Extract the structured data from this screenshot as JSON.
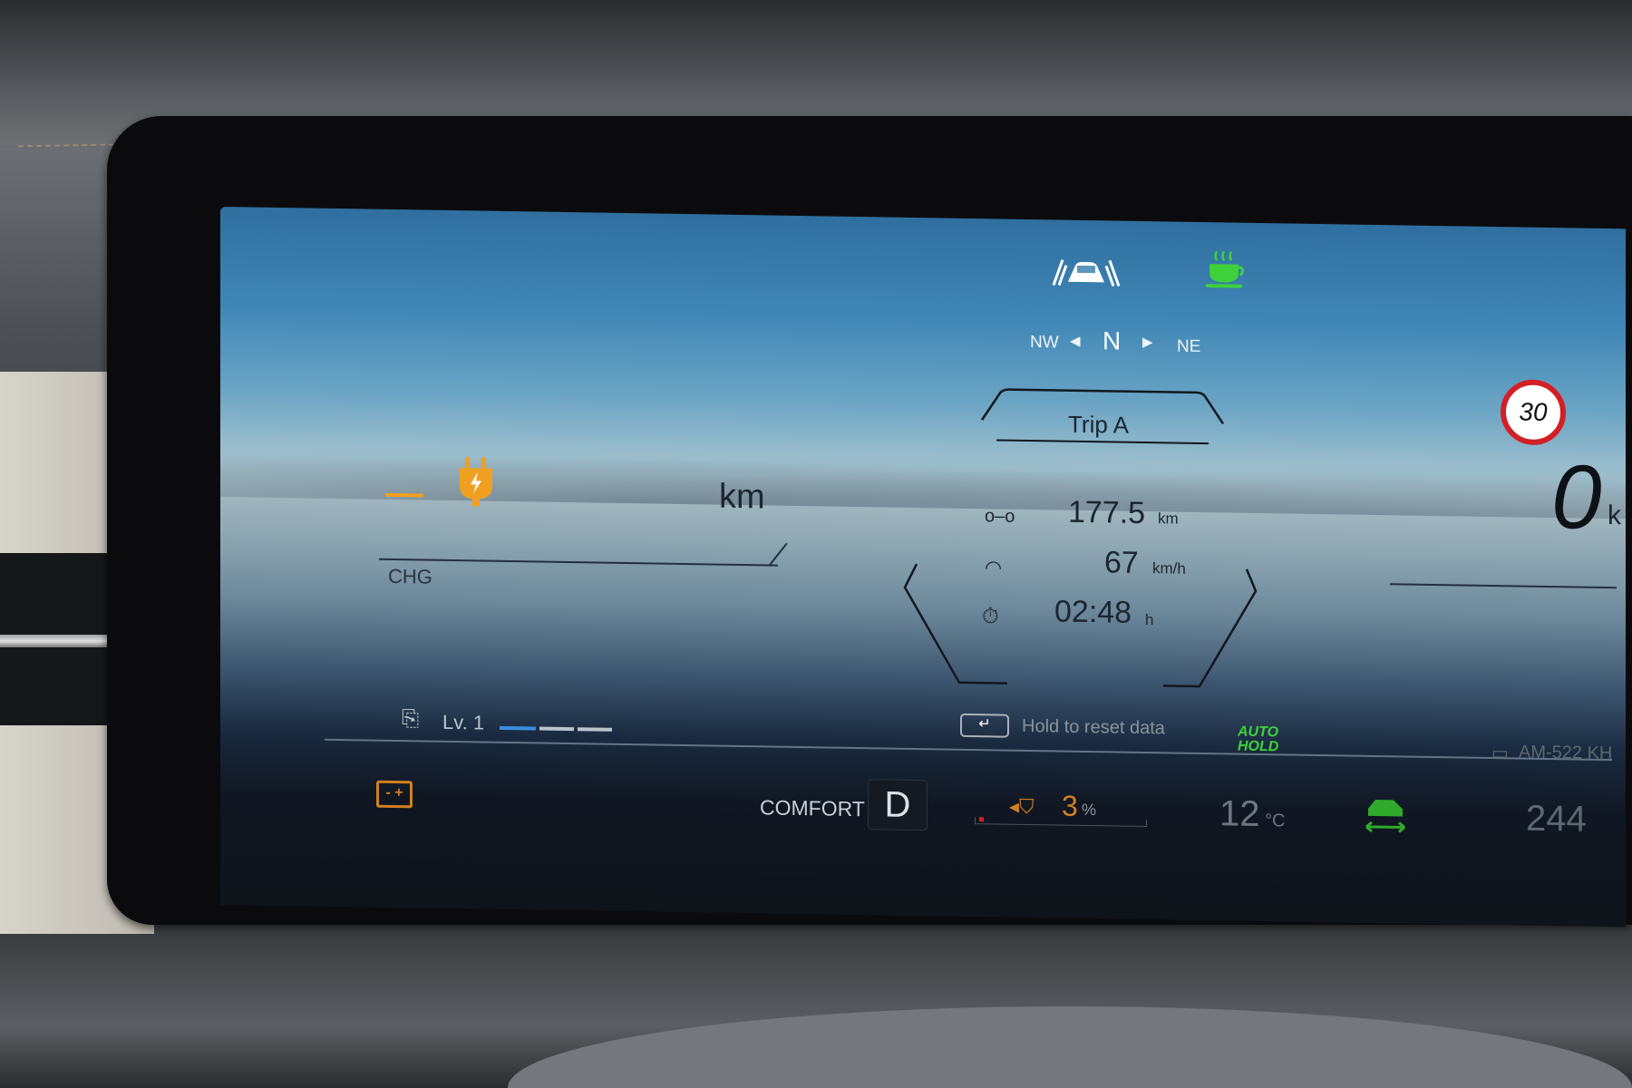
{
  "top_icons": {
    "driver_assist": "lane-assist-car-icon",
    "break_reminder": "coffee-cup-icon",
    "break_color": "#3fd13a"
  },
  "compass": {
    "left": "NW",
    "heading": "N",
    "right": "NE"
  },
  "trip": {
    "tab": "Trip A",
    "distance": "177.5",
    "distance_unit": "km",
    "avg_speed": "67",
    "avg_speed_unit": "km/h",
    "time": "02:48",
    "time_unit": "h"
  },
  "range": {
    "unit": "km",
    "mode": "CHG",
    "icon": "charging-plug-icon",
    "accent": "#f0a020"
  },
  "speed": {
    "value": "0",
    "unit": "k",
    "limit": "30"
  },
  "regen": {
    "label": "Lv. 1",
    "level": 1,
    "levels": 3
  },
  "reset": {
    "label": "Hold to reset data"
  },
  "auto_hold": {
    "line1": "AUTO",
    "line2": "HOLD",
    "color": "#3fd13a"
  },
  "radio": {
    "label": "AM-522 KH"
  },
  "status": {
    "drive_mode": "COMFORT",
    "gear": "D",
    "charge_percent": "3",
    "charge_unit": "%",
    "temperature": "12",
    "temperature_unit": "°C",
    "odometer": "244"
  }
}
